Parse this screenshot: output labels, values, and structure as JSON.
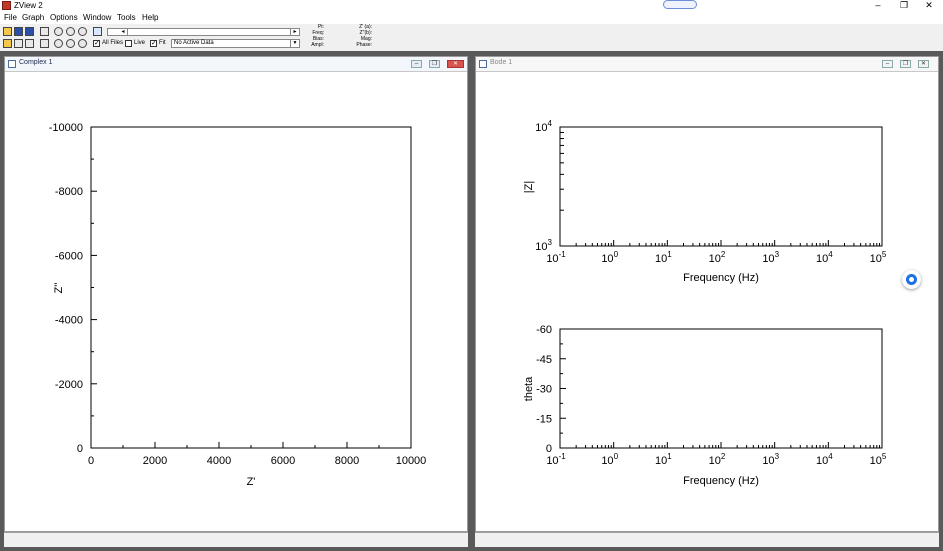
{
  "app": {
    "title": "ZView 2",
    "window_controls": {
      "minimize": "–",
      "restore": "❐",
      "close": "✕"
    }
  },
  "menu": [
    "File",
    "Graph",
    "Options",
    "Window",
    "Tools",
    "Help"
  ],
  "toolbar": {
    "all_files_label": "All Files",
    "all_files_checked": true,
    "live_label": "Live",
    "live_checked": false,
    "fit_label": "Fit",
    "fit_checked": true,
    "active_data": "No Active Data",
    "info_left": [
      "Pt:",
      "Freq:",
      "Bias:",
      "Ampl:"
    ],
    "info_right": [
      "Z' (a):",
      "Z''(b):",
      "Mag:",
      "Phase:"
    ],
    "help_label": "?"
  },
  "windows": {
    "complex": {
      "title": "Complex 1",
      "chart_data": {
        "type": "scatter",
        "xlabel": "Z'",
        "ylabel": "Z''",
        "xlim": [
          0,
          10000
        ],
        "ylim": [
          0,
          -10000
        ],
        "xticks": [
          "0",
          "2000",
          "4000",
          "6000",
          "8000",
          "10000"
        ],
        "yticks": [
          "0",
          "-2000",
          "-4000",
          "-6000",
          "-8000",
          "-10000"
        ],
        "series": []
      }
    },
    "bode": {
      "title": "Bode 1",
      "freq_label": "Frequency (Hz)",
      "x_decades": [
        "-1",
        "0",
        "1",
        "2",
        "3",
        "4",
        "5"
      ],
      "chart_data": [
        {
          "type": "line",
          "xlabel": "Frequency (Hz)",
          "ylabel": "|Z|",
          "xscale": "log",
          "xlim": [
            0.1,
            100000
          ],
          "yscale": "log",
          "ylim": [
            1000,
            10000
          ],
          "yticks_exp": [
            "3",
            "4"
          ],
          "series": []
        },
        {
          "type": "line",
          "xlabel": "Frequency (Hz)",
          "ylabel": "theta",
          "xscale": "log",
          "xlim": [
            0.1,
            100000
          ],
          "ylim": [
            0,
            -60
          ],
          "yticks": [
            "0",
            "-15",
            "-30",
            "-45",
            "-60"
          ],
          "series": []
        }
      ]
    }
  },
  "colors": {
    "accent": "#1f6fe5",
    "mdi_bg": "#5a5a5a"
  }
}
